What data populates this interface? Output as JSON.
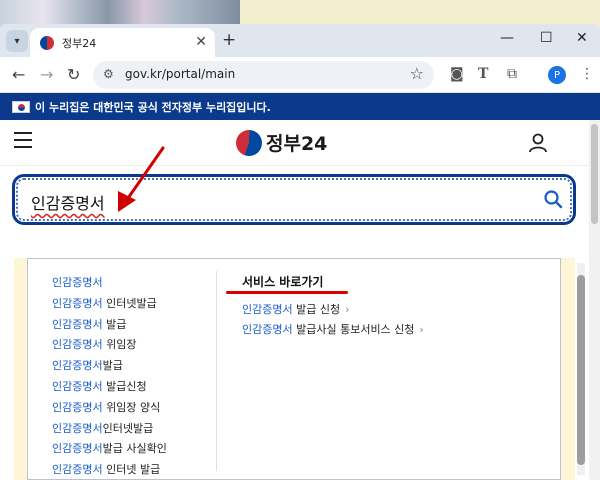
{
  "browser": {
    "tab_title": "정부24",
    "url": "gov.kr/portal/main",
    "profile_initial": "P",
    "icons": [
      "tab-search-icon",
      "close-icon",
      "new-tab-icon",
      "minimize-icon",
      "maximize-icon",
      "window-close-icon",
      "back-icon",
      "forward-icon",
      "reload-icon",
      "site-info-icon",
      "bookmark-star-icon",
      "camera-icon",
      "translate-icon",
      "extensions-icon",
      "menu-icon"
    ]
  },
  "banner": {
    "text": "이 누리집은 대한민국 공식 전자정부 누리집입니다."
  },
  "header": {
    "logo_text": "정부24"
  },
  "search": {
    "value": "인감증명서"
  },
  "suggestions": [
    {
      "highlight": "인감증명서",
      "rest": ""
    },
    {
      "highlight": "인감증명서",
      "rest": " 인터넷발급"
    },
    {
      "highlight": "인감증명서",
      "rest": " 발급"
    },
    {
      "highlight": "인감증명서",
      "rest": " 위임장"
    },
    {
      "highlight": "인감증명서",
      "rest": "발급"
    },
    {
      "highlight": "인감증명서",
      "rest": " 발급신청"
    },
    {
      "highlight": "인감증명서",
      "rest": " 위임장 양식"
    },
    {
      "highlight": "인감증명서",
      "rest": "인터넷발급"
    },
    {
      "highlight": "인감증명서",
      "rest": "발급 사실확인"
    },
    {
      "highlight": "인감증명서",
      "rest": " 인터넷 발급"
    }
  ],
  "shortcuts": {
    "title": "서비스 바로가기",
    "links": [
      {
        "highlight": "인감증명서",
        "rest": " 발급 신청"
      },
      {
        "highlight": "인감증명서",
        "rest": " 발급사실 통보서비스 신청"
      }
    ]
  },
  "colors": {
    "gov_blue": "#0b3a8c",
    "link_blue": "#1a5cc8",
    "annotation_red": "#d00000"
  }
}
